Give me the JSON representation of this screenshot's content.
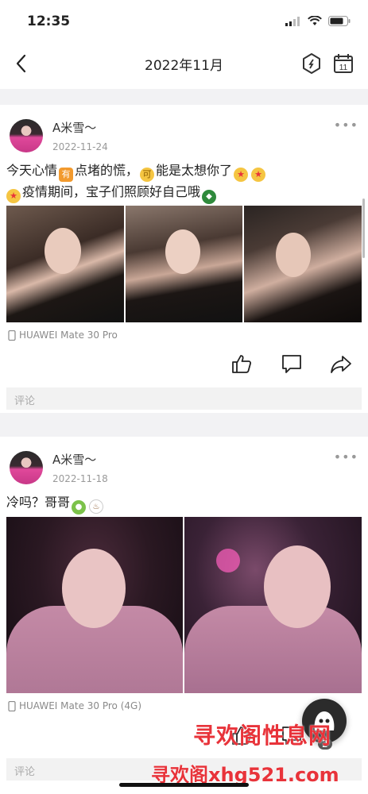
{
  "status_bar": {
    "time": "12:35"
  },
  "navbar": {
    "title": "2022年11月",
    "calendar_day": "11"
  },
  "posts": [
    {
      "name": "A米雪～",
      "date": "2022-11-24",
      "text_line1_a": "今天心情",
      "text_line1_box": "有",
      "text_line1_b": "点堵的慌，",
      "text_line1_circle": "可",
      "text_line1_c": "能是太想你了",
      "text_line2": "疫情期间，宝子们照顾好自己哦",
      "device": "HUAWEI Mate 30 Pro",
      "comment_placeholder": "评论"
    },
    {
      "name": "A米雪～",
      "date": "2022-11-18",
      "text": "冷吗？哥哥",
      "device": "HUAWEI Mate 30 Pro (4G)",
      "comment_placeholder": "评论"
    }
  ],
  "fab_badge": "2",
  "watermark": {
    "line1": "寻欢阁性息网",
    "line2": "寻欢阁xhg521.com"
  },
  "colors": {
    "accent_red": "#e8333a",
    "emoji_orange": "#f29a2e"
  }
}
